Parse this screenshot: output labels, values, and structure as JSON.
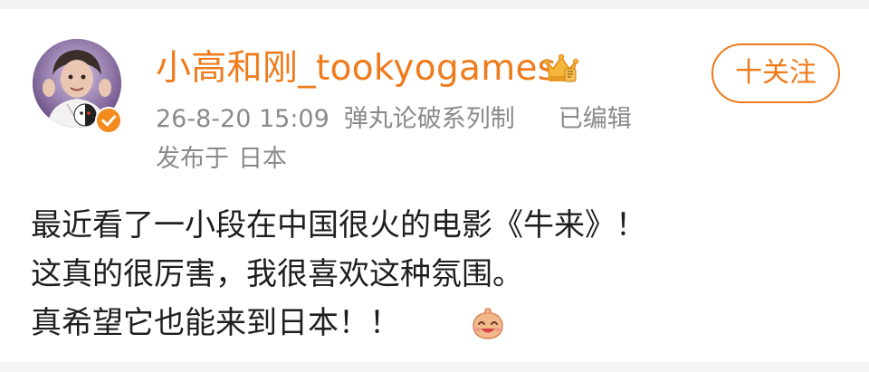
{
  "post": {
    "author": {
      "username": "小高和刚_tookyogames",
      "avatar_icon": "avatar-image",
      "verified_icon": "verified-check-icon",
      "badge_icon": "crown-level-icon"
    },
    "meta": {
      "time": "26-8-20 15:09",
      "source": "弹丸论破系列制",
      "edited": "已编辑"
    },
    "location": {
      "prefix": "发布于",
      "place": "日本"
    },
    "follow_label": "十关注",
    "content": {
      "lines": [
        "最近看了一小段在中国很火的电影《牛来》！",
        "这真的很厉害，我很喜欢这种氛围。",
        "真希望它也能来到日本！！"
      ],
      "emoji_icon": "laughing-emoji-icon"
    }
  },
  "colors": {
    "accent": "#ee7b1c",
    "meta_text": "#8a8a8a",
    "body_text": "#1e1e1e",
    "verified": "#f38b1f"
  }
}
